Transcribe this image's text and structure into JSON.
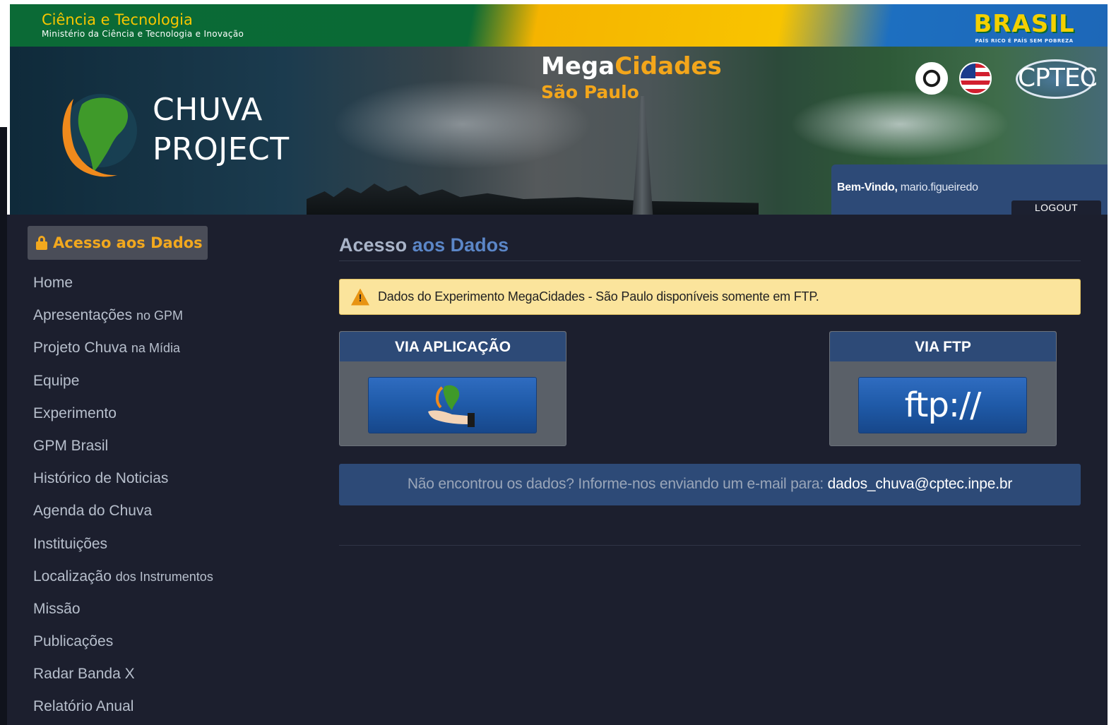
{
  "gov_bar": {
    "title": "Ciência e Tecnologia",
    "subtitle": "Ministério da Ciência e Tecnologia e Inovação",
    "brasil_logo": "BRASIL",
    "brasil_slogan": "PAÍS RICO É PAÍS SEM POBREZA"
  },
  "banner": {
    "project_line1": "CHUVA",
    "project_line2": "PROJECT",
    "mega": "Mega",
    "cidades": "Cidades",
    "city": "São Paulo",
    "cptec_logo": "CPTEC",
    "welcome_label": "Bem-Vindo,",
    "username": "mario.figueiredo",
    "logout_label": "LOGOUT"
  },
  "sidebar": {
    "header_label": "Acesso aos Dados",
    "items": [
      {
        "main": "Home",
        "small": ""
      },
      {
        "main": "Apresentações",
        "small": "no GPM"
      },
      {
        "main": "Projeto Chuva",
        "small": "na Mídia"
      },
      {
        "main": "Equipe",
        "small": ""
      },
      {
        "main": "Experimento",
        "small": ""
      },
      {
        "main": "GPM Brasil",
        "small": ""
      },
      {
        "main": "Histórico de Noticias",
        "small": ""
      },
      {
        "main": "Agenda do Chuva",
        "small": ""
      },
      {
        "main": "Instituições",
        "small": ""
      },
      {
        "main": "Localização",
        "small": "dos Instrumentos"
      },
      {
        "main": "Missão",
        "small": ""
      },
      {
        "main": "Publicações",
        "small": ""
      },
      {
        "main": "Radar Banda X",
        "small": ""
      },
      {
        "main": "Relatório Anual",
        "small": ""
      }
    ]
  },
  "content": {
    "title_part1": "Acesso",
    "title_part2": "aos Dados",
    "alert_text": "Dados do Experimento MegaCidades - São Paulo disponíveis somente em FTP.",
    "panel_app_title": "VIA APLICAÇÃO",
    "panel_ftp_title": "VIA FTP",
    "ftp_button_label": "ftp://",
    "contact_text": "Não encontrou os dados? Informe-nos enviando um e-mail para:",
    "contact_email": "dados_chuva@cptec.inpe.br"
  },
  "colors": {
    "page_bg": "#1c1f2e",
    "accent_orange": "#f2a81e",
    "panel_blue": "#2d4a77",
    "alert_bg": "#fbe49c"
  },
  "icons": {
    "lock": "lock-icon",
    "warning": "warning-icon",
    "app": "globe-hand-icon",
    "language_pt": "flag-pt-icon",
    "language_en": "flag-us-icon"
  }
}
